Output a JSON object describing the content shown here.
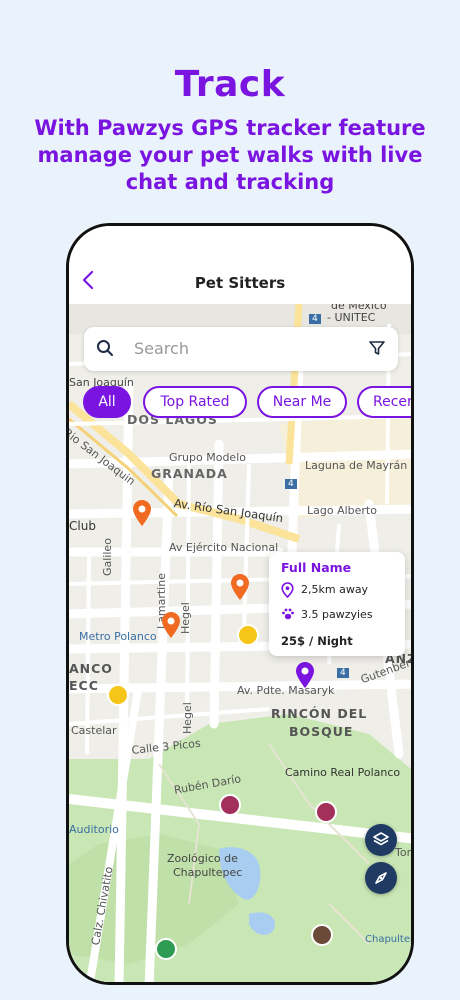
{
  "hero": {
    "title": "Track",
    "subtitle": "With Pawzys GPS tracker feature manage your pet walks with live chat and tracking"
  },
  "screen": {
    "title": "Pet Sitters",
    "back_icon": "chevron-left-icon"
  },
  "search": {
    "placeholder": "Search",
    "search_icon": "search-icon",
    "filter_icon": "filter-icon"
  },
  "filters": [
    "All",
    "Top Rated",
    "Near Me",
    "Recer"
  ],
  "active_filter": "All",
  "map": {
    "labels": {
      "dos_lagos": "DOS LAGOS",
      "granada": "GRANADA",
      "grupo_modelo": "Grupo Modelo",
      "rio_san_joaquin": "Rio San Joaquin",
      "av_rio_san_joaquin": "Av. Río San Joaquín",
      "av_ejercito": "Av Ejército Nacional",
      "laguna_mayran": "Laguna de Mayrán",
      "lago_alberto": "Lago Alberto",
      "club": "Club",
      "galileo": "Galileo",
      "lamartine": "Lamartine",
      "hegel1": "Hegel",
      "hegel2": "Hegel",
      "metro_polanco": "Metro Polanco",
      "av_masaryk": "Av. Pdte. Masaryk",
      "rincon": "RINCÓN DEL",
      "bosque": "BOSQUE",
      "calle3picos": "Calle 3 Picos",
      "ruben_dario": "Rubén Darío",
      "camino_real": "Camino Real Polanco",
      "castelar": "Castelar",
      "auditorio": "Auditorio",
      "zoologico1": "Zoológico de",
      "zoologico2": "Chapultepec",
      "calz_chivatito": "Calz. Chivatito",
      "chapultepec": "Chapultepe",
      "gutenberg": "Gutenberg",
      "anza": "ANZ",
      "anco": "ANCO",
      "ecc": "ECC",
      "unitec": "- UNITEC",
      "mexico": "de Mexico",
      "san_joaquin": "San Joaquín",
      "shield1": "4",
      "shield2": "4",
      "shield3": "4",
      "tor": "Tor"
    }
  },
  "sitter_card": {
    "name": "Full Name",
    "distance": "2,5km  away",
    "rating": "3.5 pawzyies",
    "price": "25$ / Night",
    "location_icon": "location-pin-icon",
    "paw_icon": "paw-icon"
  },
  "colors": {
    "brand": "#7a14e0",
    "pin_orange": "#f06a22",
    "pin_purple": "#7a14e0",
    "park": "#c9e7b5",
    "water": "#a9cdf0",
    "fab": "#1f3b63"
  }
}
